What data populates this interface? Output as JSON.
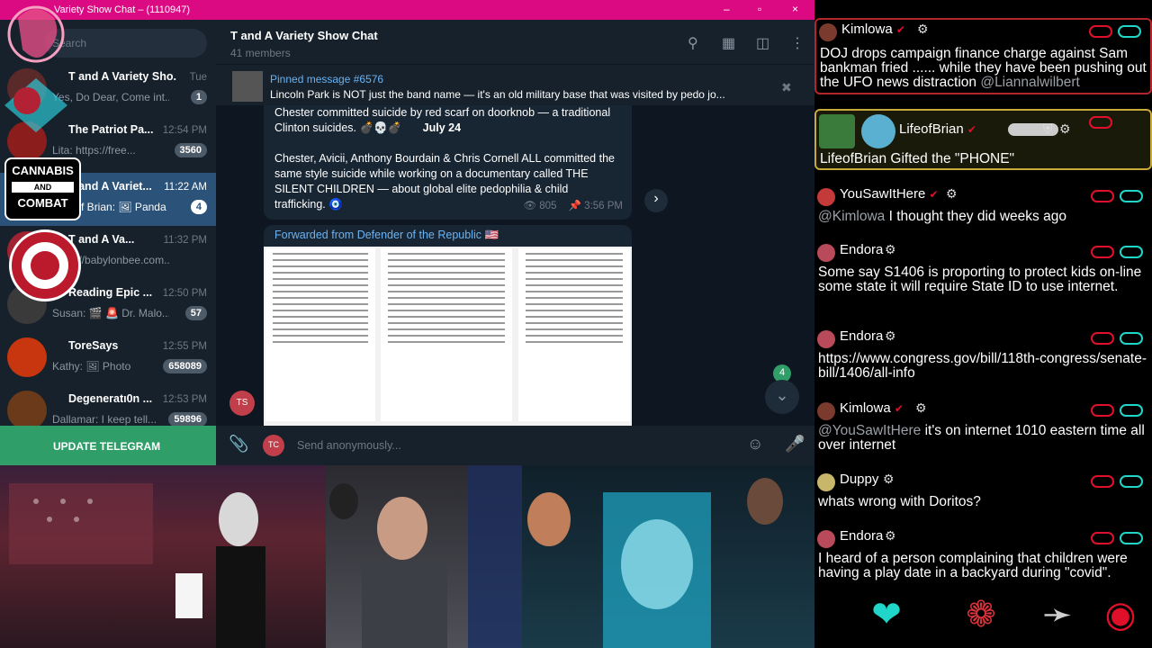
{
  "window": {
    "title": "Variety Show Chat – (1110947)",
    "controls": [
      "–",
      "▫",
      "×"
    ]
  },
  "sidebar": {
    "search_placeholder": "Search",
    "chats": [
      {
        "name": "T and A Variety Sho...",
        "time": "Tue",
        "preview": "Yes, Do Dear, Come int...",
        "badge": "1",
        "active": false
      },
      {
        "name": "The Patriot Pa...",
        "time": "12:54 PM",
        "preview": "Lita: https://free...",
        "badge": "3560",
        "active": false
      },
      {
        "name": "T and A Variet...",
        "time": "11:22 AM",
        "preview": "Life Of Brian: 🖼 Panda ...",
        "badge": "4",
        "active": true
      },
      {
        "name": "T and A Va...",
        "time": "11:32 PM",
        "preview": "https://babylonbee.com...",
        "badge": "",
        "active": false
      },
      {
        "name": "Reading Epic ...",
        "time": "12:50 PM",
        "preview": "Susan: 🎬 🚨 Dr. Malo...",
        "badge": "57",
        "active": false
      },
      {
        "name": "ToreSays",
        "time": "12:55 PM",
        "preview": "Kathy: 🖼 Photo",
        "badge": "658089",
        "active": false
      },
      {
        "name": "Degeneratı0n ...",
        "time": "12:53 PM",
        "preview": "Dallamar: I keep tell...",
        "badge": "59896",
        "active": false
      }
    ],
    "update_label": "UPDATE TELEGRAM"
  },
  "header": {
    "title": "T and A Variety Show Chat",
    "subtitle": "41 members"
  },
  "pinned": {
    "label": "Pinned message #6576",
    "text": "Lincoln Park is NOT just the band name — it's an old military base that was visited by pedo jo..."
  },
  "messages": {
    "m1": {
      "line1": "Chester committed suicide by red scarf on doorknob — a traditional Clinton suicides. 💣💀💣",
      "date": "July 24",
      "para2": "Chester, Avicii, Anthony Bourdain & Chris Cornell ALL committed the same style suicide while working on a documentary called THE SILENT CHILDREN — about global elite pedophilia & child trafficking. 🧿",
      "views": "805",
      "time": "3:56 PM"
    },
    "m2": {
      "forwarded": "Forwarded from Defender of the Republic 🇺🇸"
    },
    "sender_initials": "TS",
    "unread_count": "4"
  },
  "composer": {
    "initials": "TC",
    "placeholder": "Send anonymously..."
  },
  "overlay": {
    "cannabis_top": "CANNABIS",
    "cannabis_mid": "AND",
    "cannabis_bottom": "COMBAT"
  },
  "livechat": [
    {
      "user": "Kimlowa",
      "mention": "",
      "text": "DOJ drops campaign finance charge against Sam bankman fried ...... while they have been pushing out the UFO news distraction ",
      "tail_mention": "@Liannalwilbert",
      "color": "#7a3b2e"
    },
    {
      "user": "LifeofBrian",
      "mention": "",
      "text": "LifeofBrian Gifted the \"PHONE\"",
      "tail_mention": "",
      "color": "#2c5c6e"
    },
    {
      "user": "YouSawItHere",
      "mention": "@Kimlowa",
      "text": " I thought they did weeks ago",
      "tail_mention": "",
      "color": "#c43a3a"
    },
    {
      "user": "Endora",
      "mention": "",
      "text": "Some say S1406 is proporting to protect kids on-line some state it will require State ID to use internet.",
      "tail_mention": "",
      "color": "#b84a5a"
    },
    {
      "user": "Endora",
      "mention": "",
      "text": "https://www.congress.gov/bill/118th-congress/senate-bill/1406/all-info",
      "tail_mention": "",
      "color": "#b84a5a"
    },
    {
      "user": "Kimlowa",
      "mention": "@YouSawItHere",
      "text": " it's on internet 1010 eastern time all over internet",
      "tail_mention": "",
      "color": "#7a3b2e"
    },
    {
      "user": "Duppy",
      "mention": "",
      "text": "whats wrong with Doritos?",
      "tail_mention": "",
      "color": "#c8b76a"
    },
    {
      "user": "Endora",
      "mention": "",
      "text": "I heard of a person complaining that children were having a play date in a backyard during \"covid\".",
      "tail_mention": "",
      "color": "#b84a5a"
    }
  ],
  "colors": {
    "titlebar": "#dc0a82",
    "accent_blue": "#6ab3f3",
    "active_chat": "#2b5278",
    "update_green": "#2f9e68",
    "pill_red": "#e0102a",
    "pill_cyan": "#20d6c8"
  }
}
